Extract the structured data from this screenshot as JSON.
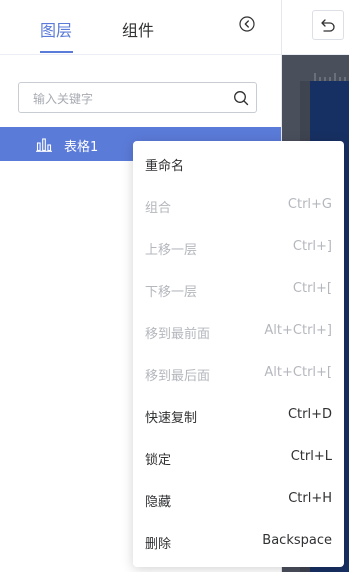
{
  "tabs": [
    {
      "label": "图层",
      "active": true
    },
    {
      "label": "组件",
      "active": false
    }
  ],
  "search": {
    "placeholder": "输入关键字",
    "value": ""
  },
  "layers": [
    {
      "label": "表格1",
      "icon": "bar-chart-icon",
      "selected": true
    }
  ],
  "context_menu": {
    "items": [
      {
        "label": "重命名",
        "shortcut": "",
        "disabled": false
      },
      {
        "label": "组合",
        "shortcut": "Ctrl+G",
        "disabled": true
      },
      {
        "label": "上移一层",
        "shortcut": "Ctrl+]",
        "disabled": true
      },
      {
        "label": "下移一层",
        "shortcut": "Ctrl+[",
        "disabled": true
      },
      {
        "label": "移到最前面",
        "shortcut": "Alt+Ctrl+]",
        "disabled": true
      },
      {
        "label": "移到最后面",
        "shortcut": "Alt+Ctrl+[",
        "disabled": true
      },
      {
        "label": "快速复制",
        "shortcut": "Ctrl+D",
        "disabled": false
      },
      {
        "label": "锁定",
        "shortcut": "Ctrl+L",
        "disabled": false
      },
      {
        "label": "隐藏",
        "shortcut": "Ctrl+H",
        "disabled": false
      },
      {
        "label": "删除",
        "shortcut": "Backspace",
        "disabled": false
      }
    ]
  },
  "colors": {
    "accent": "#5b7bd9",
    "canvas_bg": "#3f4451",
    "canvas_page": "#173063",
    "disabled_text": "#b4b7bd"
  }
}
